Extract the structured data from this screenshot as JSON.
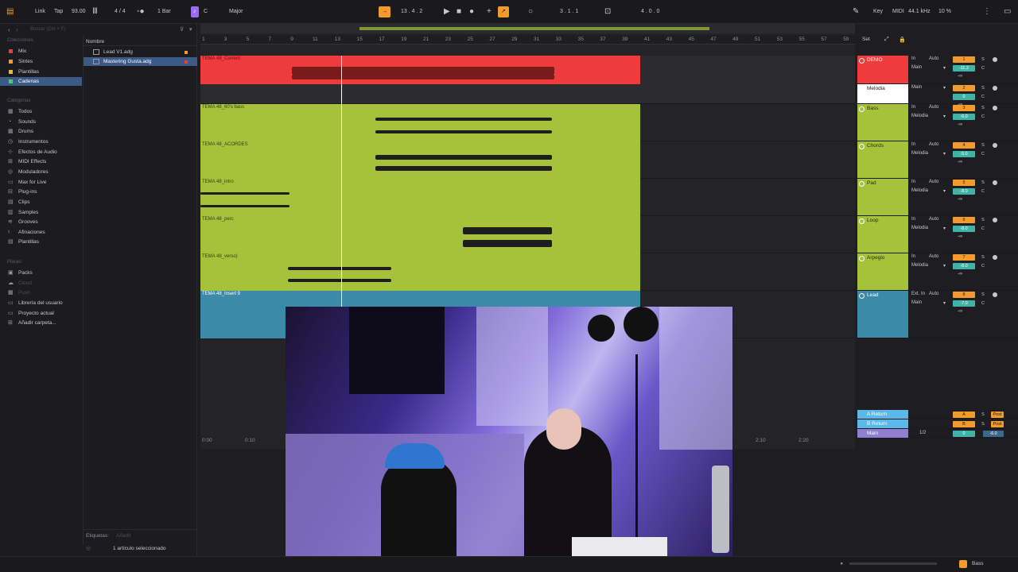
{
  "topbar": {
    "link": "Link",
    "tap": "Tap",
    "tempo": "93.00",
    "signature": "4 / 4",
    "quantize": "1 Bar",
    "key": "C",
    "scale": "Major",
    "position": "13 .  4 .  2",
    "loop_start": "3 .  1 .  1",
    "loop_length": "4 .  0 .  0",
    "key_label": "Key",
    "midi_label": "MIDI",
    "sample_rate": "44.1 kHz",
    "cpu": "10 %"
  },
  "browser": {
    "search_placeholder": "Buscar (Ctrl + F)",
    "collections_header": "Colecciones",
    "collections": [
      {
        "label": "Mix",
        "color": "#ef3b3b"
      },
      {
        "label": "Sintes",
        "color": "#f29b2c"
      },
      {
        "label": "Plantillas",
        "color": "#e6c02a"
      },
      {
        "label": "Cadenas",
        "color": "#3fd46a"
      }
    ],
    "categories_header": "Categorías",
    "categories": [
      {
        "label": "Todos",
        "icon": "grid-icon"
      },
      {
        "label": "Sounds",
        "icon": "sounds-icon"
      },
      {
        "label": "Drums",
        "icon": "drums-icon"
      },
      {
        "label": "Instrumentos",
        "icon": "instrument-icon"
      },
      {
        "label": "Efectos de Audio",
        "icon": "audio-effect-icon"
      },
      {
        "label": "MIDI Effects",
        "icon": "midi-effect-icon"
      },
      {
        "label": "Moduladores",
        "icon": "modulator-icon"
      },
      {
        "label": "Max for Live",
        "icon": "max-icon"
      },
      {
        "label": "Plug-ins",
        "icon": "plugin-icon"
      },
      {
        "label": "Clips",
        "icon": "clips-icon"
      },
      {
        "label": "Samples",
        "icon": "samples-icon"
      },
      {
        "label": "Grooves",
        "icon": "grooves-icon"
      },
      {
        "label": "Afinaciones",
        "icon": "tuning-icon"
      },
      {
        "label": "Plantillas",
        "icon": "templates-icon"
      }
    ],
    "places_header": "Places",
    "places": [
      {
        "label": "Packs",
        "dim": false
      },
      {
        "label": "Cloud",
        "dim": true
      },
      {
        "label": "Push",
        "dim": true
      },
      {
        "label": "Librería del usuario",
        "dim": false
      },
      {
        "label": "Proyecto actual",
        "dim": false
      },
      {
        "label": "Añadir carpeta...",
        "dim": false
      }
    ],
    "column_header": "Nombre",
    "files": [
      {
        "label": "Lead V1.adg",
        "dot": "#f29b2c"
      },
      {
        "label": "Mastering Gusta.adg",
        "dot": "#ef3b3b"
      }
    ],
    "tags_label": "Etiquetas:",
    "tags_add": "Añadir",
    "selection_count": "1 artículo seleccionado"
  },
  "arrangement": {
    "bar_numbers": [
      "1",
      "3",
      "5",
      "7",
      "9",
      "11",
      "13",
      "15",
      "17",
      "19",
      "21",
      "23",
      "25",
      "27",
      "29",
      "31",
      "33",
      "35",
      "37",
      "39",
      "41",
      "43",
      "45",
      "47",
      "49",
      "51",
      "53",
      "55",
      "57",
      "59"
    ],
    "time_labels": [
      "0:00",
      "0:10",
      "2:10",
      "2:20"
    ],
    "clips": [
      {
        "name": "TEMA 48_Current",
        "color": "red"
      },
      {
        "name": "TEMA 48_60's bass",
        "color": "green"
      },
      {
        "name": "TEMA 48_ACORDES",
        "color": "green"
      },
      {
        "name": "TEMA 48_intro",
        "color": "green"
      },
      {
        "name": "TEMA 48_perc",
        "color": "green"
      },
      {
        "name": "TEMA 48_verso)",
        "color": "green"
      },
      {
        "name": "TEMA 48_Insert 9",
        "color": "teal"
      }
    ]
  },
  "mixer": {
    "set_label": "Set",
    "tracks": [
      {
        "name": "DEMO",
        "color": "#ef3b3b",
        "text": "#ffffff",
        "input": "In",
        "monitor": "Auto",
        "routing": "Main",
        "num": "1",
        "vol": "-11.2",
        "send": "-∞"
      },
      {
        "name": "Melodia",
        "color": "#ffffff",
        "text": "#222222",
        "input": "",
        "monitor": "",
        "routing": "Main",
        "num": "2",
        "vol": "0",
        "send": "-∞"
      },
      {
        "name": "Bass",
        "color": "#a6c13a",
        "text": "#2a3010",
        "input": "In",
        "monitor": "Auto",
        "routing": "Melodia",
        "num": "3",
        "vol": "-6.0",
        "send": "-∞"
      },
      {
        "name": "Chords",
        "color": "#a6c13a",
        "text": "#2a3010",
        "input": "In",
        "monitor": "Auto",
        "routing": "Melodia",
        "num": "4",
        "vol": "-5.0",
        "send": "-∞"
      },
      {
        "name": "Pad",
        "color": "#a6c13a",
        "text": "#2a3010",
        "input": "In",
        "monitor": "Auto",
        "routing": "Melodia",
        "num": "5",
        "vol": "-8.0",
        "send": "-∞"
      },
      {
        "name": "Loop",
        "color": "#a6c13a",
        "text": "#2a3010",
        "input": "In",
        "monitor": "Auto",
        "routing": "Melodia",
        "num": "6",
        "vol": "-8.0",
        "send": "-∞"
      },
      {
        "name": "Arpegio",
        "color": "#a6c13a",
        "text": "#2a3010",
        "input": "In",
        "monitor": "Auto",
        "routing": "Melodia",
        "num": "7",
        "vol": "-8.0",
        "send": "-∞"
      },
      {
        "name": "Lead",
        "color": "#3a8aa8",
        "text": "#ffffff",
        "input": "Ext. In",
        "monitor": "Auto",
        "routing": "Main",
        "num": "8",
        "vol": "-7.0",
        "send": "-∞"
      }
    ],
    "returns": [
      {
        "name": "A Return",
        "letter": "A",
        "post": "Post"
      },
      {
        "name": "B Return",
        "letter": "B",
        "post": "Post"
      }
    ],
    "main": {
      "name": "Main",
      "routing": "1/2",
      "vol": "0",
      "pan": "-6.0"
    }
  },
  "footer": {
    "track_label": "Bass"
  }
}
